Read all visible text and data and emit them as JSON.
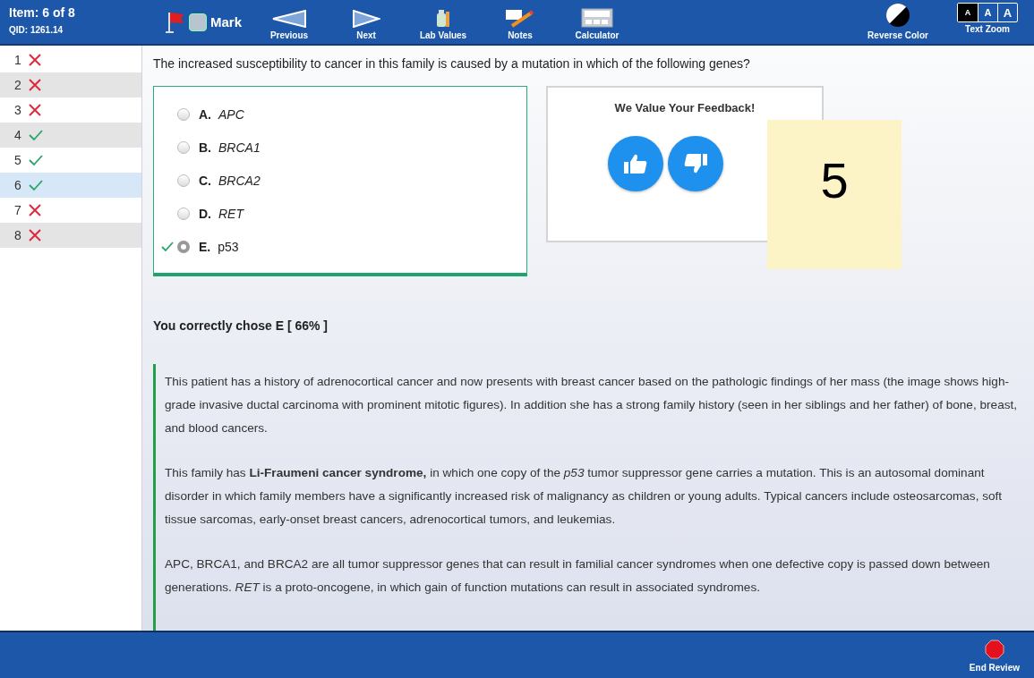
{
  "header": {
    "item": "Item: 6 of 8",
    "qid": "QID: 1261.14",
    "mark": {
      "label": "Mark",
      "checked": false
    },
    "tools": [
      {
        "kind": "previous",
        "label": "Previous"
      },
      {
        "kind": "next",
        "label": "Next"
      },
      {
        "kind": "lab",
        "label": "Lab Values"
      },
      {
        "kind": "notes",
        "label": "Notes"
      },
      {
        "kind": "calculator",
        "label": "Calculator"
      }
    ],
    "reverse_color": "Reverse Color",
    "text_zoom": {
      "label": "Text Zoom",
      "sizes": [
        {
          "label": "A",
          "selected": true
        },
        {
          "label": "A",
          "selected": false
        },
        {
          "label": "A",
          "selected": false
        }
      ]
    }
  },
  "sidebar": {
    "items": [
      {
        "number": "1",
        "correct": false,
        "selected": false
      },
      {
        "number": "2",
        "correct": false,
        "selected": false
      },
      {
        "number": "3",
        "correct": false,
        "selected": false
      },
      {
        "number": "4",
        "correct": true,
        "selected": false
      },
      {
        "number": "5",
        "correct": true,
        "selected": false
      },
      {
        "number": "6",
        "correct": true,
        "selected": true
      },
      {
        "number": "7",
        "correct": false,
        "selected": false
      },
      {
        "number": "8",
        "correct": false,
        "selected": false
      }
    ]
  },
  "question": "The increased susceptibility to cancer in this family is caused by a mutation in which of the following genes?",
  "options": [
    {
      "letter": "A.",
      "text": "APC",
      "italic": true,
      "selected": false,
      "correct": false
    },
    {
      "letter": "B.",
      "text": "BRCA1",
      "italic": true,
      "selected": false,
      "correct": false
    },
    {
      "letter": "C.",
      "text": "BRCA2",
      "italic": true,
      "selected": false,
      "correct": false
    },
    {
      "letter": "D.",
      "text": "RET",
      "italic": true,
      "selected": false,
      "correct": false
    },
    {
      "letter": "E.",
      "text": "p53",
      "italic": false,
      "selected": true,
      "correct": true
    }
  ],
  "feedback": {
    "title": "We Value Your Feedback!"
  },
  "sticky_note": "5",
  "result": "You correctly chose E [ 66% ]",
  "explanation": [
    "This patient has a history of adrenocortical cancer and now presents with breast cancer based on the pathologic findings of her mass (the image shows high-grade invasive ductal carcinoma with prominent mitotic figures). In addition she has a strong family history (seen in her siblings and her father) of bone, breast, and blood cancers.",
    "This family has **Li-Fraumeni cancer syndrome,** in which one copy of the *p53* tumor suppressor gene carries a mutation. This is an autosomal dominant disorder in which family members have a significantly increased risk of malignancy as children or young adults. Typical cancers include osteosarcomas, soft tissue sarcomas, early-onset breast cancers, adrenocortical tumors, and leukemias.",
    "APC, BRCA1, and BRCA2 are all tumor suppressor genes that can result in familial cancer syndromes when one defective copy is passed down between generations. *RET*  is a proto-oncogene, in which gain of function mutations can result in associated syndromes."
  ],
  "footer": {
    "end_review": "End Review"
  }
}
